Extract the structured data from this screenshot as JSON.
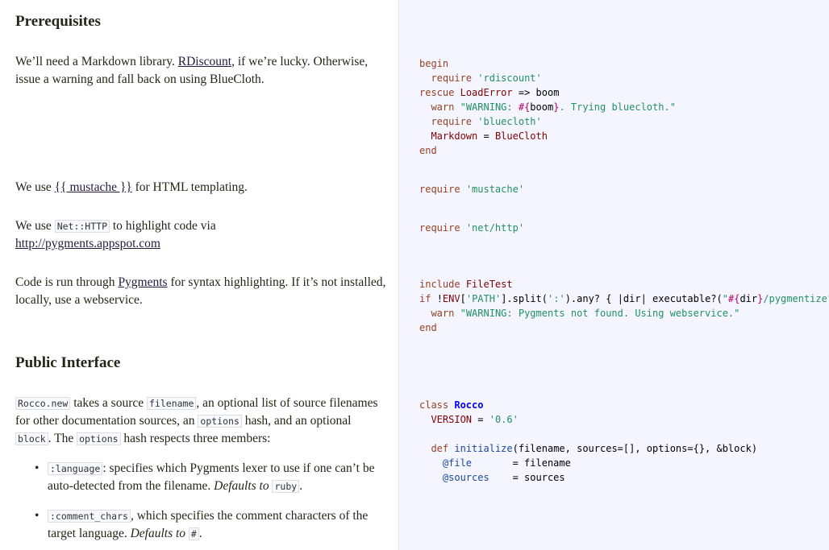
{
  "docs": {
    "prereq_heading": "Prerequisites",
    "markdown_para": {
      "t1": "We’ll need a Markdown library. ",
      "link": "RDiscount",
      "t2": ", if we’re lucky. Otherwise, issue a warning and fall back on using BlueCloth."
    },
    "mustache_para": {
      "t1": "We use ",
      "link": "{{ mustache }}",
      "t2": " for HTML templating."
    },
    "http_para": {
      "t1": "We use ",
      "code": "Net::HTTP",
      "t2": " to highlight code via ",
      "link": "http://pygments.appspot.com"
    },
    "pygments_para": {
      "t1": "Code is run through ",
      "link": "Pygments",
      "t2": " for syntax highlighting. If it’s not installed, locally, use a webservice."
    },
    "public_heading": "Public Interface",
    "rocco_para": {
      "code1": "Rocco.new",
      "t1": " takes a source ",
      "code2": "filename",
      "t2": ", an optional list of source filenames for other documentation sources, an ",
      "code3": "options",
      "t3": " hash, and an optional ",
      "code4": "block",
      "t4": ". The ",
      "code5": "options",
      "t5": " hash respects three members:"
    },
    "list": [
      {
        "code": ":language",
        "t1": ": specifies which Pygments lexer to use if one can’t be auto-detected from the filename. ",
        "em": "Defaults to",
        "code2": "ruby",
        "t2": "."
      },
      {
        "code": ":comment_chars",
        "t1": ", which specifies the comment characters of the target language. ",
        "em": "Defaults to",
        "code2": "#",
        "t2": "."
      }
    ]
  },
  "code": {
    "kw": {
      "begin": "begin",
      "require": "require",
      "rescue": "rescue",
      "warn": "warn",
      "end": "end",
      "include": "include",
      "if": "if",
      "class": "class",
      "def": "def"
    },
    "str": {
      "rdiscount": "'rdiscount'",
      "warn1_a": "\"WARNING: ",
      "interp_open": "#{",
      "interp_close": "}",
      "warn1_b": ". Trying bluecloth.\"",
      "bluecloth": "'bluecloth'",
      "mustache": "'mustache'",
      "nethttp": "'net/http'",
      "path": "'PATH'",
      "colon": "':'",
      "pygq_a": "\"",
      "pygq_b": "/pygmentize\"",
      "warn2": "\"WARNING: Pygments not found. Using webservice.\"",
      "version": "'0.6'"
    },
    "ident": {
      "loaderror": "LoadError",
      "arrow_boom": " => boom",
      "boom": "boom",
      "markdown": "Markdown",
      "eq": " = ",
      "bluecloth_c": "BlueCloth",
      "filetest": "FileTest",
      "bang": "!",
      "env": "ENV",
      "bracket_open": "[",
      "split_a": "].split(",
      "split_b": ").any? { |dir| executable?(",
      "dir": "dir",
      "close_paren": ")",
      "rocco": "Rocco",
      "version_c": "VERSION",
      "initialize": "initialize",
      "params": "(filename, sources=[], options={}, &block)",
      "ivar_file": "@file",
      "ivar_file_rhs": "       = filename",
      "ivar_sources": "@sources",
      "ivar_sources_rhs": "    = sources"
    }
  }
}
